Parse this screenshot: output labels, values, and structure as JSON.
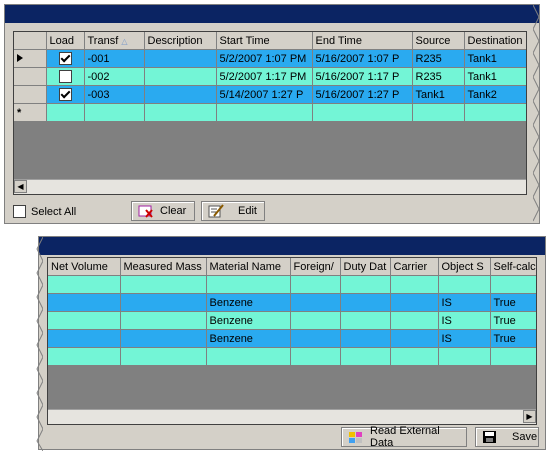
{
  "transfers": {
    "columns": [
      "Load",
      "Transf",
      "Description",
      "Start Time",
      "End Time",
      "Source",
      "Destination"
    ],
    "sort_indicator": "△",
    "rows": [
      {
        "load": true,
        "transf": "-001",
        "description": "",
        "start": "5/2/2007 1:07 PM",
        "end": "5/16/2007 1:07 P",
        "source": "R235",
        "destination": "Tank1"
      },
      {
        "load": false,
        "transf": "-002",
        "description": "",
        "start": "5/2/2007 1:17 PM",
        "end": "5/16/2007 1:17 P",
        "source": "R235",
        "destination": "Tank1"
      },
      {
        "load": true,
        "transf": "-003",
        "description": "",
        "start": "5/14/2007 1:27 P",
        "end": "5/16/2007 1:27 P",
        "source": "Tank1",
        "destination": "Tank2"
      }
    ],
    "new_row_marker": "*",
    "select_all_label": "Select All",
    "clear_label": "Clear",
    "edit_label": "Edit"
  },
  "materials": {
    "columns": [
      "Net Volume",
      "Measured Mass",
      "Material Name",
      "Foreign/",
      "Duty Dat",
      "Carrier",
      "Object S",
      "Self-calc"
    ],
    "rows": [
      {
        "net_volume": "",
        "measured_mass": "",
        "material": "Benzene",
        "foreign": "",
        "duty": "",
        "carrier": "",
        "object": "IS",
        "selfcalc": "True"
      },
      {
        "net_volume": "",
        "measured_mass": "",
        "material": "Benzene",
        "foreign": "",
        "duty": "",
        "carrier": "",
        "object": "IS",
        "selfcalc": "True"
      },
      {
        "net_volume": "",
        "measured_mass": "",
        "material": "Benzene",
        "foreign": "",
        "duty": "",
        "carrier": "",
        "object": "IS",
        "selfcalc": "True"
      }
    ],
    "read_label": "Read External Data",
    "save_label": "Save"
  },
  "colors": {
    "title_bar": "#0b2463",
    "row_blue": "#2aaaf0",
    "row_teal": "#73f5d6",
    "grid_bg": "#808080"
  }
}
